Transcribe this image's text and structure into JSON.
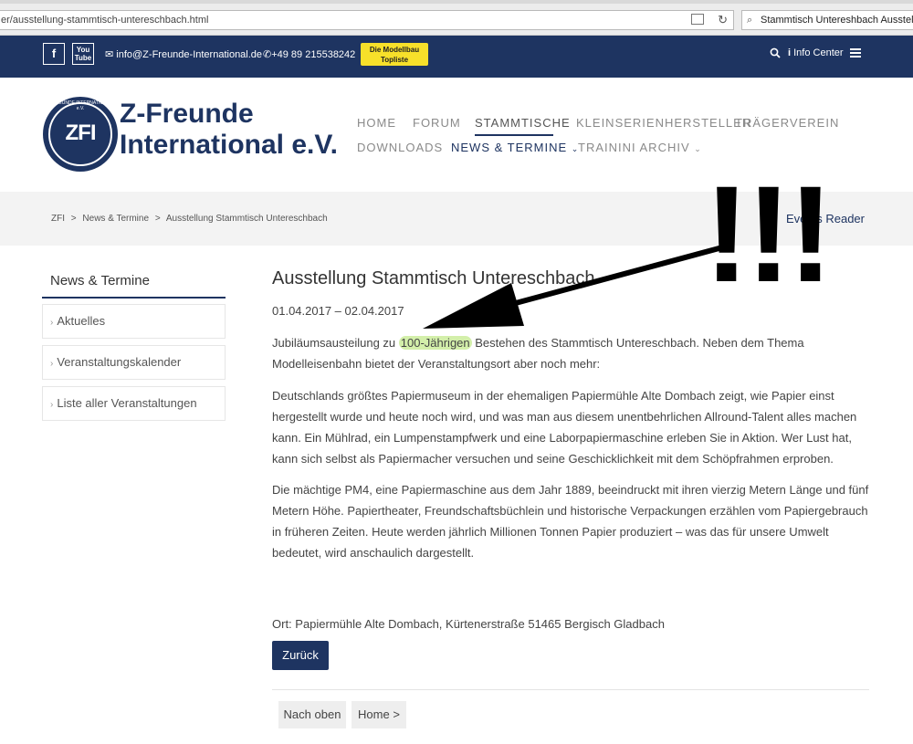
{
  "browser": {
    "url": "er/ausstellung-stammtisch-untereschbach.html",
    "search_value": "Stammtisch Untereshbach Ausstellung"
  },
  "topbar": {
    "facebook_label": "f",
    "youtube_label": "You Tube",
    "email": "info@Z-Freunde-International.de",
    "phone": "+49 89 215538242",
    "badge_line1": "Die Modellbau",
    "badge_line2": "Topliste",
    "info_center": "Info Center"
  },
  "logo": {
    "line1": "Z-Freunde",
    "line2": "International e.V.",
    "emblem_text": "ZFI",
    "emblem_arc": "Z-FREUNDE INTERNATIONAL e.V."
  },
  "nav": {
    "home": "HOME",
    "forum": "FORUM",
    "stammtische": "STAMMTISCHE",
    "kleinserien": "KLEINSERIENHERSTELLER",
    "traeger": "TRÄGERVEREIN",
    "downloads": "DOWNLOADS",
    "news": "NEWS & TERMINE",
    "trainini": "TRAININI ARCHIV"
  },
  "breadcrumb": {
    "items": [
      "ZFI",
      "News & Termine",
      "Ausstellung Stammtisch Untereschbach"
    ],
    "sep": ">"
  },
  "events_reader": "Events Reader",
  "sidebar": {
    "title": "News & Termine",
    "items": [
      "Aktuelles",
      "Veranstaltungskalender",
      "Liste aller Veranstaltungen"
    ]
  },
  "article": {
    "title": "Ausstellung Stammtisch Untereschbach",
    "date": "01.04.2017 – 02.04.2017",
    "p1_before": "Jubiläumsausteilung zu ",
    "p1_highlight": "100-Jährigen",
    "p1_after": " Bestehen des Stammtisch Untereschbach. Neben dem Thema Modelleisenbahn  bietet der Veranstaltungsort aber noch mehr:",
    "p2": "Deutschlands größtes Papiermuseum in der ehemaligen Papiermühle Alte Dombach zeigt, wie Papier einst hergestellt wurde und heute noch wird, und was man aus diesem unentbehrlichen Allround-Talent alles machen kann. Ein Mühlrad, ein Lumpenstampfwerk und eine Laborpapiermaschine erleben Sie in Aktion. Wer Lust hat, kann sich selbst als Papiermacher versuchen und seine Geschicklichkeit mit dem Schöpfrahmen erproben.",
    "p3": "Die mächtige PM4, eine Papiermaschine aus dem Jahr 1889, beeindruckt mit ihren vierzig Metern Länge und fünf Metern Höhe. Papiertheater, Freundschaftsbüchlein und historische Verpackungen erzählen vom Papiergebrauch in früheren Zeiten. Heute werden jährlich Millionen Tonnen Papier produziert – was das für unsere Umwelt bedeutet, wird anschaulich dargestellt.",
    "location": "Ort: Papiermühle Alte Dombach, Kürtenerstraße 51465 Bergisch Gladbach",
    "back_button": "Zurück"
  },
  "pager": {
    "top": "Nach oben",
    "home": "Home >"
  },
  "annotation": {
    "text": "!!!"
  },
  "colors": {
    "brand": "#1e3461",
    "badge": "#f7e02a",
    "highlight": "#d3efaa"
  }
}
